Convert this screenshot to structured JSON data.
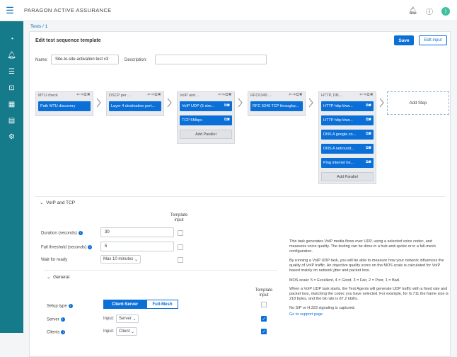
{
  "app": {
    "brand": "PARAGON ACTIVE ASSURANCE"
  },
  "breadcrumb": "Tests / 1",
  "page": {
    "title": "Edit test sequence template",
    "save": "Save",
    "edit_input": "Edit input"
  },
  "form": {
    "name_label": "Name:",
    "name_value": "Site-to-site activation test v3",
    "description_label": "Description:",
    "description_value": ""
  },
  "steps": [
    {
      "title": "MTU check",
      "cards": [
        "Path MTU discovery"
      ]
    },
    {
      "title": "DSCP per ...",
      "cards": [
        "Layer 4 destination port..."
      ]
    },
    {
      "title": "VoIP and ...",
      "cards": [
        "VoIP UDP (5 stre...",
        "TCP 5Mbps"
      ],
      "add_parallel": "Add Parallel"
    },
    {
      "title": "RFC6349 ...",
      "cards": [
        "RFC 6349 TCP throughp..."
      ]
    },
    {
      "title": "HTTP, DN...",
      "cards": [
        "HTTP http://ww...",
        "HTTP http://ww...",
        "DNS A google.co...",
        "DNS A netround...",
        "Ping internet he..."
      ],
      "add_parallel": "Add Parallel"
    }
  ],
  "add_step": "Add Step",
  "voip_section": {
    "title": "VoIP and TCP",
    "template_input_header": "Template input",
    "fields": [
      {
        "label": "Duration (seconds)",
        "value": "30"
      },
      {
        "label": "Fail threshold (seconds)",
        "value": "5"
      },
      {
        "label": "Wait for ready",
        "value": "Max 10 minutes"
      }
    ]
  },
  "general_section": {
    "title": "General",
    "template_input_header": "Template input",
    "setup_type_label": "Setup type",
    "setup_options": [
      "Client-Server",
      "Full-Mesh"
    ],
    "server_label": "Server",
    "server_prefix": "Input:",
    "server_value": "Server",
    "clients_label": "Clients",
    "clients_prefix": "Input:",
    "clients_value": "Client"
  },
  "description": [
    "This task generates VoIP media flows over UDP, using a selected voice codec, and measures voice quality. The testing can be done in a hub-and-spoke or in a full-mesh configuration.",
    "By running a VoIP UDP task, you will be able to measure how your network influences the quality of VoIP traffic. An objective quality score on the MOS scale is calculated for VoIP based mainly on network jitter and packet loss.",
    "MOS scale: 5 = Excellent, 4 = Good, 3 = Fair, 2 = Poor, 1 = Bad.",
    "When a VoIP UDP task starts, the Test Agents will generate UDP traffic with a fixed rate and packet loss, matching the codec you have selected. For example, for G.711 the frame size is 218 bytes, and the bit rate is 87.2 kbit/s.",
    "No SIP or H.323 signaling is captured.",
    "Go to support page"
  ]
}
